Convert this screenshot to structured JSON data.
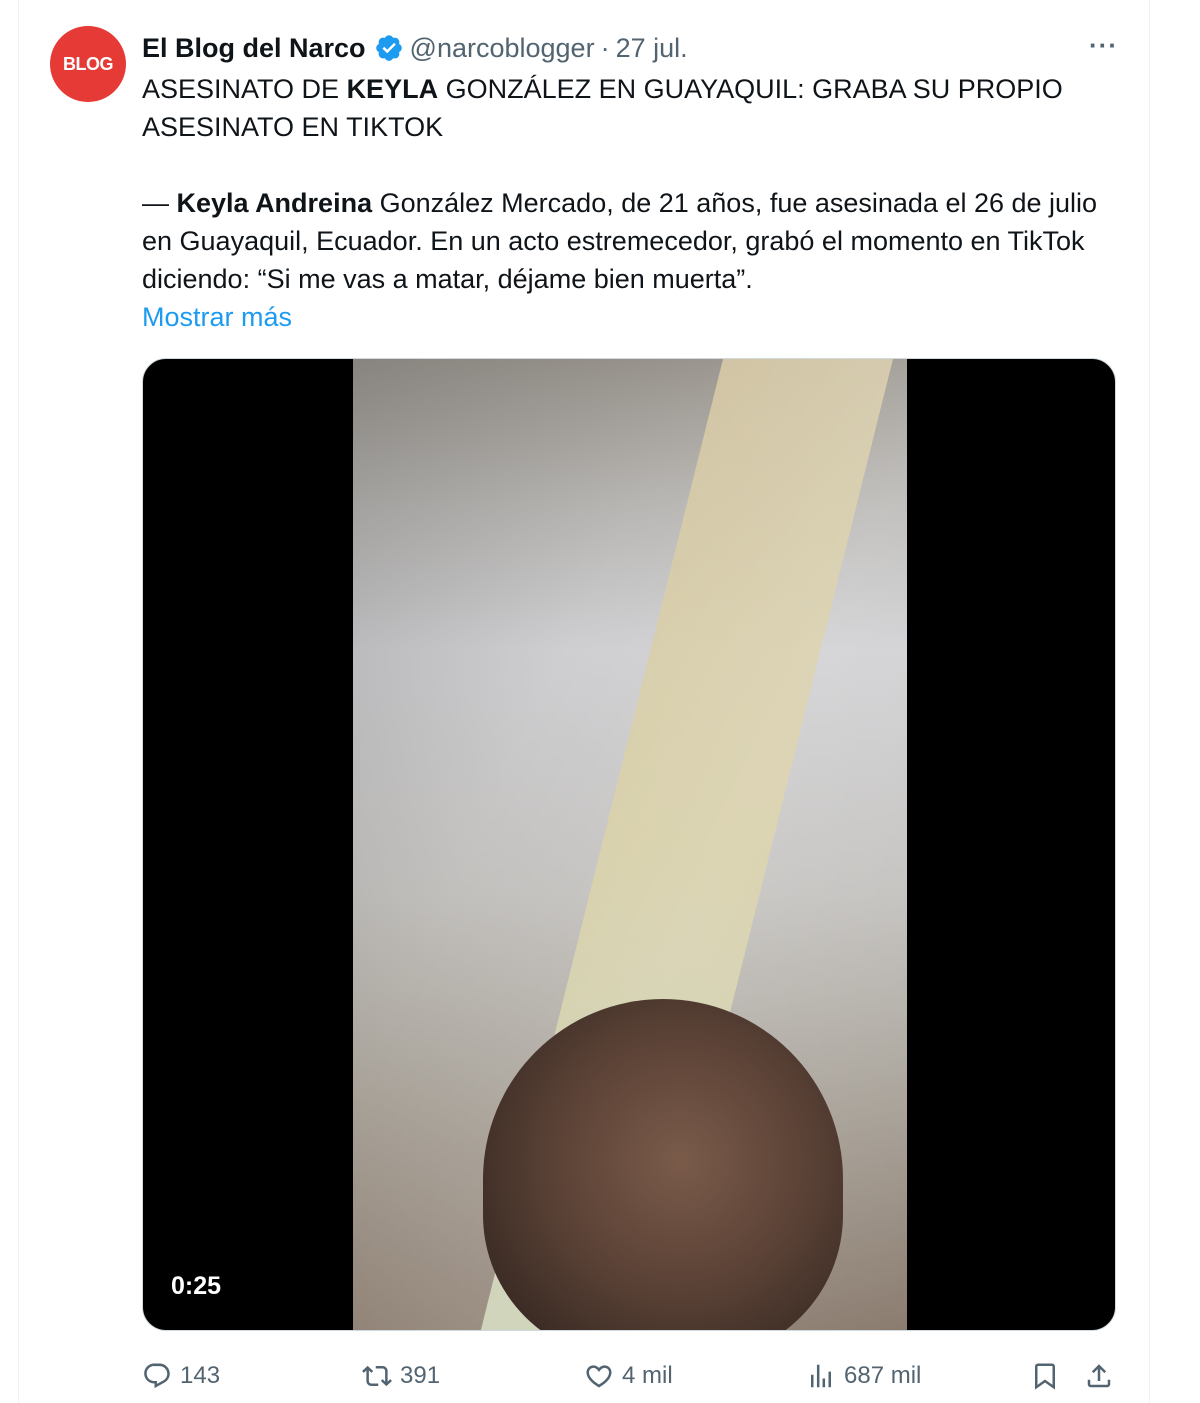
{
  "tweet": {
    "author_name": "El Blog del Narco",
    "handle": "@narcoblogger",
    "separator": "·",
    "timestamp": "27 jul.",
    "more_icon": "more-horizontal-icon",
    "avatar_text": "BLOG",
    "headline": {
      "part1": "ASESINATO DE ",
      "bold": "KEYLA",
      "part2": " GONZÁLEZ EN GUAYAQUIL: GRABA SU PROPIO ASESINATO EN TIKTOK"
    },
    "body": {
      "dash": "— ",
      "bold": "Keyla Andreina",
      "rest": " González Mercado, de 21 años, fue asesinada el 26 de julio en Guayaquil, Ecuador. En un acto estremecedor, grabó el momento en TikTok diciendo: “Si me vas a matar, déjame bien muerta”."
    },
    "show_more": "Mostrar más",
    "media": {
      "duration": "0:25"
    },
    "actions": {
      "replies": "143",
      "retweets": "391",
      "likes": "4 mil",
      "views": "687 mil"
    },
    "colors": {
      "accent": "#1d9bf0",
      "avatar_bg": "#e53a35",
      "muted": "#536471"
    }
  }
}
